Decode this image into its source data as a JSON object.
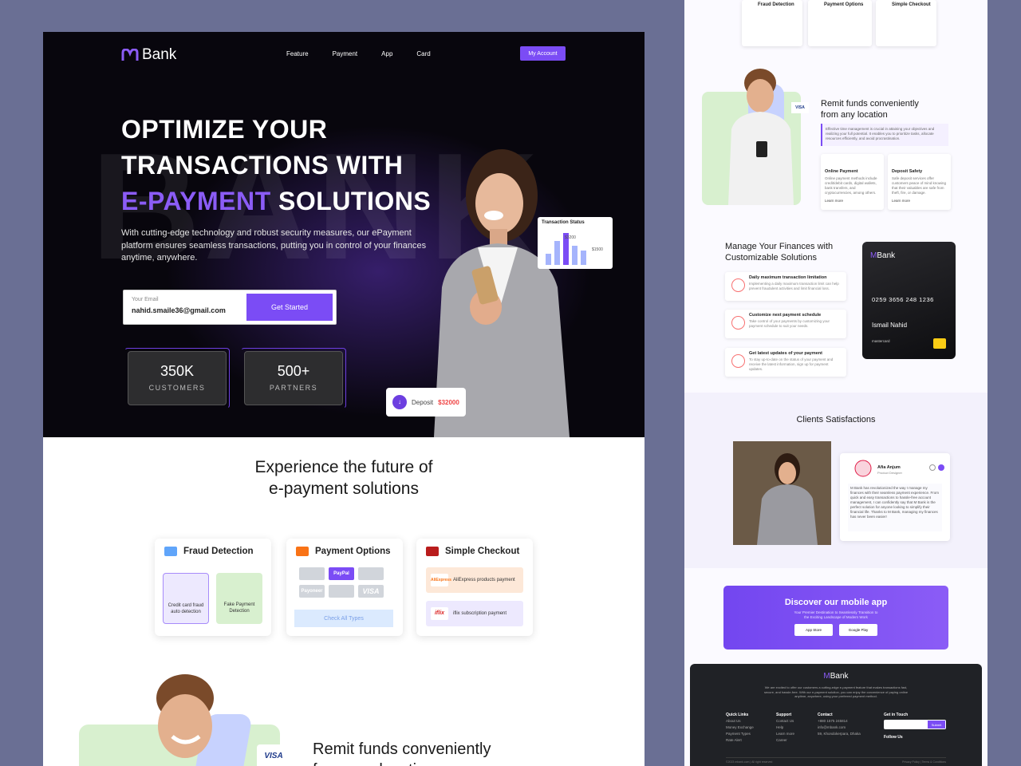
{
  "brand": {
    "name": "Bank",
    "accent": "#7b4cf5"
  },
  "nav": {
    "items": [
      "Feature",
      "Payment",
      "App",
      "Card"
    ],
    "account_label": "My Account"
  },
  "hero": {
    "bg_word": "BANK",
    "line1": "OPTIMIZE YOUR",
    "line2": "TRANSACTIONS WITH",
    "line3_accent": "E-PAYMENT",
    "line3_rest": " SOLUTIONS",
    "lead": "With cutting-edge technology and robust security measures, our ePayment platform ensures seamless transactions, putting you in control of your finances anytime, anywhere.",
    "email_label": "Your Email",
    "email_value": "nahid.smaile36@gmail.com",
    "cta": "Get Started",
    "stats": [
      {
        "value": "350K",
        "label": "CUSTOMERS"
      },
      {
        "value": "500+",
        "label": "PARTNERS"
      }
    ],
    "transaction_title": "Transaction Status",
    "transaction_values": [
      "$3200",
      "$1500"
    ],
    "transaction_bars": [
      0.35,
      0.75,
      1.0,
      0.6,
      0.45
    ],
    "deposit_label": "Deposit",
    "deposit_amount": "$32000"
  },
  "experience": {
    "title_line1": "Experience the future of",
    "title_line2": "e-payment solutions"
  },
  "features": {
    "fraud": {
      "title": "Fraud Detection",
      "tile1": "Credit card fraud auto detection",
      "tile2": "Fake Payment Detection"
    },
    "payment": {
      "title": "Payment Options",
      "chips": [
        "",
        "PayPal",
        "",
        "Payoneer",
        "",
        "VISA"
      ],
      "cta": "Check All Types"
    },
    "checkout": {
      "title": "Simple Checkout",
      "row1_logo": "AliExpress",
      "row1": "AliExpress products payment",
      "row2_logo": "iflix",
      "row2": "iflix subscription payment"
    }
  },
  "remit": {
    "visa": "VISA",
    "title_line1": "Remit funds conveniently",
    "title_line2": "from any location"
  },
  "right": {
    "mini": [
      "Fraud Detection",
      "Payment Options",
      "Simple Checkout"
    ],
    "remit_title1": "Remit funds conveniently",
    "remit_title2": "from any location",
    "remit_desc": "Effective time management is crucial in attaining your objectives and realizing your full potential. It enables you to prioritize tasks, allocate resources efficiently, and avoid procrastination.",
    "remit_visa": "VISA",
    "small1_title": "Online Payment",
    "small1_desc": "Online payment methods include credit/debit cards, digital wallets, bank transfers, and cryptocurrencies, among others.",
    "small2_title": "Deposit Safety",
    "small2_desc": "Safe deposit services offer customers peace of mind knowing that their valuables are safe from theft, fire, or damage.",
    "learn_more": "Learn more",
    "manage_title1": "Manage Your Finances with",
    "manage_title2": "Customizable Solutions",
    "manage_items": [
      {
        "title": "Daily maximum transaction limitation",
        "desc": "Implementing a daily maximum transaction limit can help prevent fraudulent activities and limit financial loss."
      },
      {
        "title": "Customize next payment schedule",
        "desc": "Take control of your payments by customizing your payment schedule to suit your needs."
      },
      {
        "title": "Get latest updates of your payment",
        "desc": "To stay up-to-date on the status of your payment and receive the latest information, sign up for payment updates."
      }
    ],
    "card_brand": "Bank",
    "card_number": "0259  3656  248  1236",
    "card_name": "Ismail Nahid",
    "card_network": "mastercard",
    "clients_title": "Clients Satisfactions",
    "reviewer_name": "Afia Anjum",
    "reviewer_role": "Product Designer",
    "review_text": "M Bank has revolutionized the way I manage my finances with their seamless payment experience. From quick and easy transactions to hassle-free account management, I can confidently say that M Bank is the perfect solution for anyone looking to simplify their financial life. Thanks to M Bank, managing my finances has never been easier!",
    "app_title": "Discover our mobile app",
    "app_desc": "Your Premier Destination to Seamlessly Transition to the Exciting Landscape of Modern Work",
    "app_store": "App Store",
    "google_play": "Google Play",
    "footer_desc": "We are excited to offer our customers a cutting-edge e-payment feature that makes transactions fast, secure, and hassle-free. With our e-payment solution, you can enjoy the convenience of paying online anytime, anywhere, using your preferred payment method.",
    "footer_cols": [
      {
        "h": "Quick Links",
        "items": [
          "About Us",
          "Money Exchange",
          "Payment Types",
          "Rate Alert"
        ]
      },
      {
        "h": "Support",
        "items": [
          "Contact Us",
          "Help",
          "Learn more",
          "Career"
        ]
      },
      {
        "h": "Contact",
        "items": [
          "+880 1575 245814",
          "info@mbank.com",
          "59, Khondokerpara, Dhaka"
        ]
      }
    ],
    "touch_title": "Get in Touch",
    "subscribe": "Submit",
    "follow": "Follow Us",
    "copyright": "©2023 mbank.com | All right reserved",
    "policy": "Privacy Policy | Terms & Conditions"
  }
}
